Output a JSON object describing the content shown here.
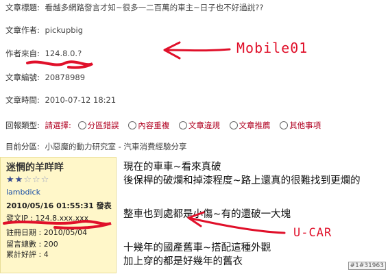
{
  "meta_rows": [
    {
      "label": "文章標題:",
      "value": "看越多網路發言才知~很多一二百萬的車主~日子也不好過說??"
    },
    {
      "label": "文章作者:",
      "value": "pickupbig"
    },
    {
      "label": "作者來自:",
      "value": "124.8.0.?"
    },
    {
      "label": "文章編號:",
      "value": "20878989"
    },
    {
      "label": "文章時間:",
      "value": "2010-07-12 18:21"
    }
  ],
  "report": {
    "label": "回報類型:",
    "prompt": "請選擇:",
    "options": [
      "分區錯誤",
      "內容重複",
      "文章違規",
      "文章推薦",
      "其他事項"
    ]
  },
  "category": {
    "label": "目前分區:",
    "value": "小惡魔的動力研究室 - 汽車消費經驗分享"
  },
  "annotations": {
    "top": "Mobile01",
    "bottom": "U-CAR"
  },
  "user": {
    "name": "迷惘的羊咩咩",
    "rating": 2,
    "rating_max": 5,
    "link": "lambdick",
    "post_time": "2010/05/16 01:55:31 發表",
    "ip_label": "發文IP : ",
    "ip": "124.8.xxx.xxx",
    "register": "註冊日期 : 2010/05/04",
    "messages": "留言總數 : 200",
    "likes": "累計好評 : 4"
  },
  "post_lines": [
    "現在的車車~看來真破",
    "後保桿的破爛和掉漆程度~路上還真的很難找到更爛的",
    "整車也到處都是小傷~有的還破一大塊",
    "十幾年的國產舊車~搭配這種外觀",
    "加上穿的都是好幾年的舊衣"
  ],
  "post_id": "#1#31963"
}
